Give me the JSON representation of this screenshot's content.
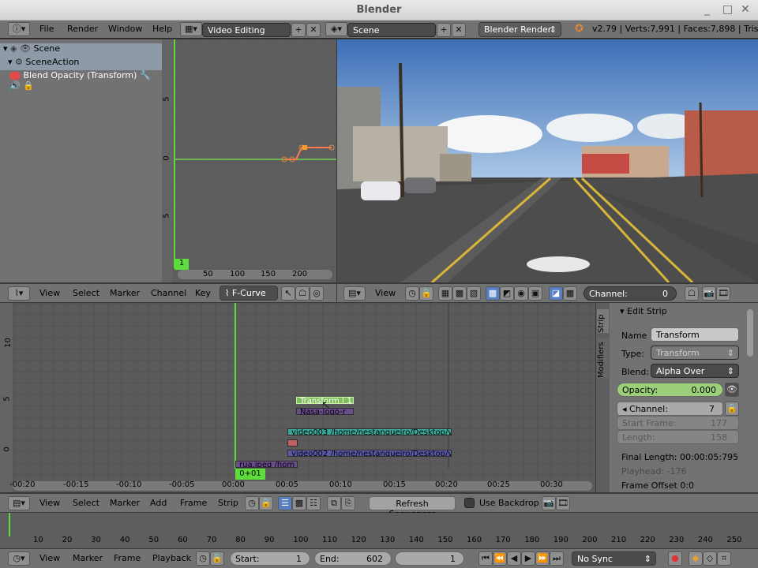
{
  "window": {
    "title": "Blender"
  },
  "info_header": {
    "menus": [
      "File",
      "Render",
      "Window",
      "Help"
    ],
    "screen_layout": "Video Editing",
    "scene": "Scene",
    "render_engine": "Blender Render",
    "stats": "v2.79 | Verts:7,991 | Faces:7,898 | Tris:15,7"
  },
  "outliner": {
    "rows": [
      {
        "label": "Scene",
        "icon": "scene-icon"
      },
      {
        "label": "SceneAction",
        "icon": "action-icon"
      },
      {
        "label": "Blend Opacity (Transform)",
        "icon": "fcurve-icon"
      }
    ]
  },
  "graph_editor": {
    "y_ticks": [
      "5",
      "0",
      "5"
    ],
    "x_ticks": [
      "50",
      "100",
      "150",
      "200"
    ],
    "current_frame": "1",
    "header": {
      "menus": [
        "View",
        "Select",
        "Marker",
        "Channel",
        "Key"
      ],
      "mode": "F-Curve"
    }
  },
  "viewer_header": {
    "menus": [
      "View"
    ],
    "channel_label": "Channel:",
    "channel_value": "0"
  },
  "sequencer": {
    "y_ticks": [
      "10",
      "5",
      "0"
    ],
    "x_ticks": [
      "-00:20",
      "-00:15",
      "-00:10",
      "-00:05",
      "00:00",
      "00:05",
      "00:10",
      "00:15",
      "00:20",
      "00:25",
      "00:30"
    ],
    "current_time": "0+01",
    "strips": [
      {
        "label": "Transform | 1",
        "type": "effect",
        "color": "#7fbf5a"
      },
      {
        "label": "Nasa-logo-r",
        "type": "image",
        "color": "#6a4d8c"
      },
      {
        "label": "video003 /home/nestanqueiro/Desktop/v",
        "type": "movie",
        "color": "#3aa89a"
      },
      {
        "label": "",
        "type": "color",
        "color": "#c06060"
      },
      {
        "label": "video002 /home/nestanqueiro/Desktop/v",
        "type": "movie",
        "color": "#5a5aa8"
      },
      {
        "label": "rua.jpeg /hom",
        "type": "image",
        "color": "#6a4d8c"
      }
    ],
    "header": {
      "menus": [
        "View",
        "Select",
        "Marker",
        "Add",
        "Frame",
        "Strip"
      ],
      "refresh_button": "Refresh Sequencer",
      "use_backdrop": "Use Backdrop"
    }
  },
  "properties": {
    "tabs": [
      "Strip",
      "Modifiers"
    ],
    "panel_title": "Edit Strip",
    "name_label": "Name",
    "name_value": "Transform",
    "type_label": "Type:",
    "type_value": "Transform",
    "blend_label": "Blend:",
    "blend_value": "Alpha Over",
    "opacity_label": "Opacity:",
    "opacity_value": "0.000",
    "channel_label": "Channel:",
    "channel_value": "7",
    "start_label": "Start Frame:",
    "start_value": "177",
    "length_label": "Length:",
    "length_value": "158",
    "final_length": "Final Length: 00:00:05:795",
    "playhead": "Playhead: -176",
    "frame_offset": "Frame Offset 0:0"
  },
  "timeline": {
    "ticks": [
      "10",
      "20",
      "30",
      "40",
      "50",
      "60",
      "70",
      "80",
      "90",
      "100",
      "110",
      "120",
      "130",
      "140",
      "150",
      "160",
      "170",
      "180",
      "190",
      "200",
      "210",
      "220",
      "230",
      "240",
      "250"
    ],
    "header": {
      "menus": [
        "View",
        "Marker",
        "Frame",
        "Playback"
      ],
      "start_label": "Start:",
      "start_value": "1",
      "end_label": "End:",
      "end_value": "602",
      "current_value": "1",
      "sync": "No Sync"
    }
  }
}
